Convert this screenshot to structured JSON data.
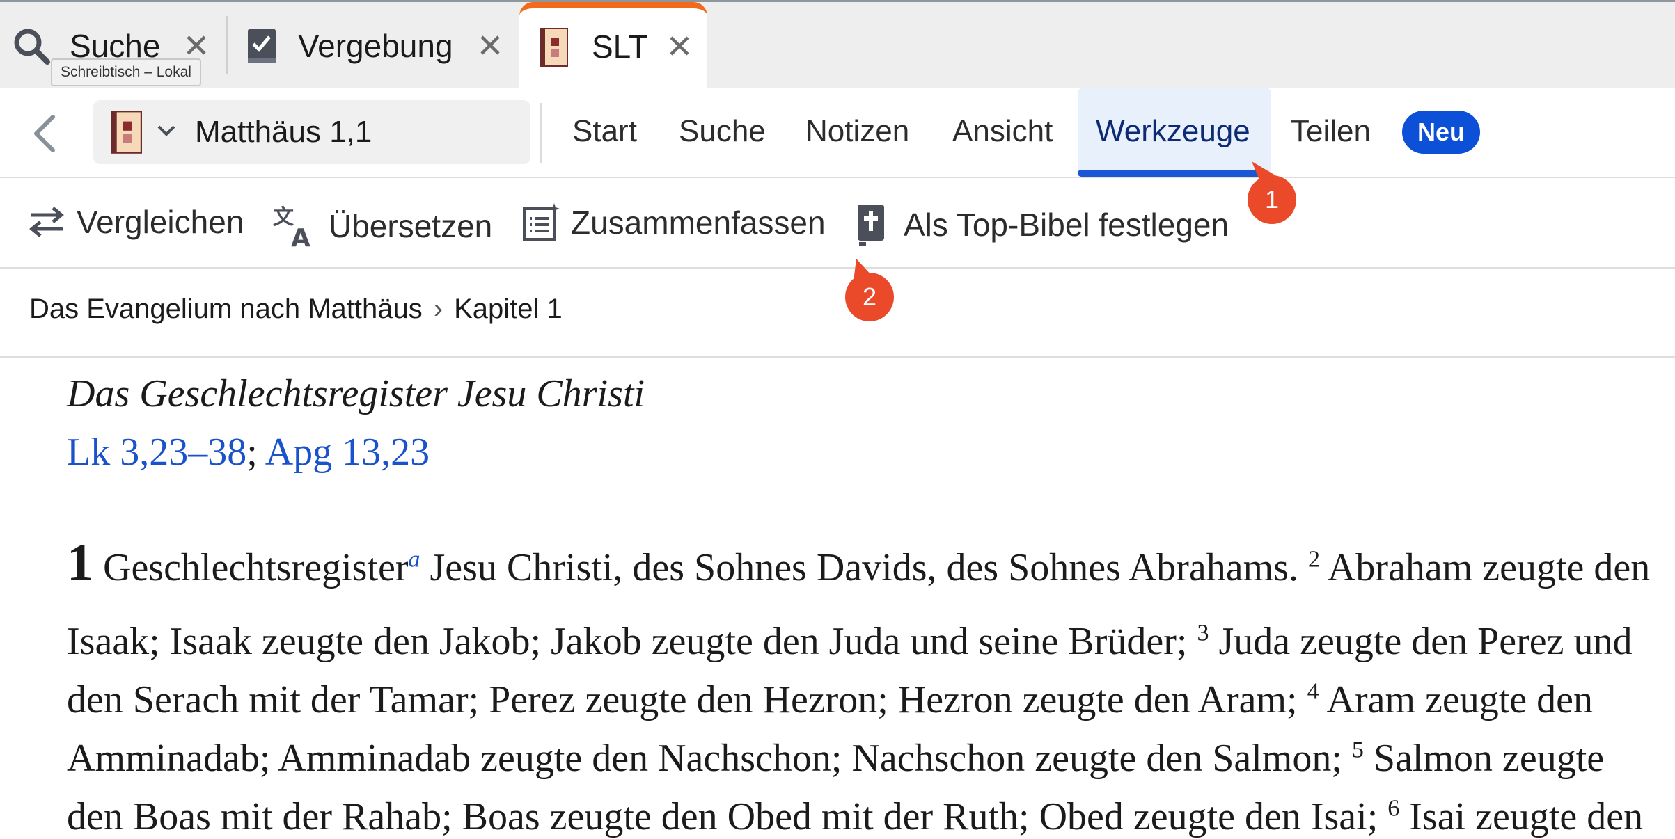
{
  "tabs": [
    {
      "label": "Suche",
      "icon": "search-icon"
    },
    {
      "label": "Vergebung",
      "icon": "notebook-check-icon"
    },
    {
      "label": "SLT",
      "icon": "bible-book-icon",
      "active": true
    }
  ],
  "tooltip": "Schreibtisch – Lokal",
  "toolbar": {
    "reference": "Matthäus 1,1",
    "menu": [
      "Start",
      "Suche",
      "Notizen",
      "Ansicht",
      "Werkzeuge",
      "Teilen"
    ],
    "active_menu": "Werkzeuge",
    "badge": "Neu"
  },
  "tools": [
    {
      "label": "Vergleichen",
      "icon": "compare-arrows-icon"
    },
    {
      "label": "Übersetzen",
      "icon": "translate-icon"
    },
    {
      "label": "Zusammenfassen",
      "icon": "summarize-icon"
    },
    {
      "label": "Als Top-Bibel festlegen",
      "icon": "bible-cross-icon"
    }
  ],
  "breadcrumb": {
    "book": "Das Evangelium nach Matthäus",
    "chapter": "Kapitel 1",
    "separator": "›"
  },
  "passage": {
    "heading": "Das Geschlechtsregister Jesu Christi",
    "crossrefs": [
      "Lk 3,23–38",
      "Apg 13,23"
    ],
    "crossref_sep": ";",
    "chapter": "1",
    "footnote": "a",
    "line1_a": "Geschlechtsregister",
    "line1_b": " Jesu Christi, des Sohnes Davids, des Sohnes Abrahams. ",
    "v2": "2",
    "line1_c": " Abraham zeugte den",
    "line2_a": "Isaak; Isaak zeugte den Jakob; Jakob zeugte den Juda und seine Brüder; ",
    "v3": "3",
    "line2_b": " Juda zeugte den Perez und",
    "line3_a": "den Serach mit der Tamar; Perez zeugte den Hezron; Hezron zeugte den Aram; ",
    "v4": "4",
    "line3_b": " Aram zeugte den",
    "line4_a": "Amminadab; Amminadab zeugte den Nachschon; Nachschon zeugte den Salmon; ",
    "v5": "5",
    "line4_b": " Salmon zeugte",
    "line5_a": "den Boas mit der Rahab; Boas zeugte den Obed mit der Ruth; Obed zeugte den Isai; ",
    "v6": "6",
    "line5_b": " Isai zeugte den"
  },
  "callouts": [
    "1",
    "2"
  ],
  "colors": {
    "accent_tab": "#f26b1d",
    "active_blue": "#1a56d6",
    "link_blue": "#1a52cc",
    "callout": "#ea4a2a"
  }
}
